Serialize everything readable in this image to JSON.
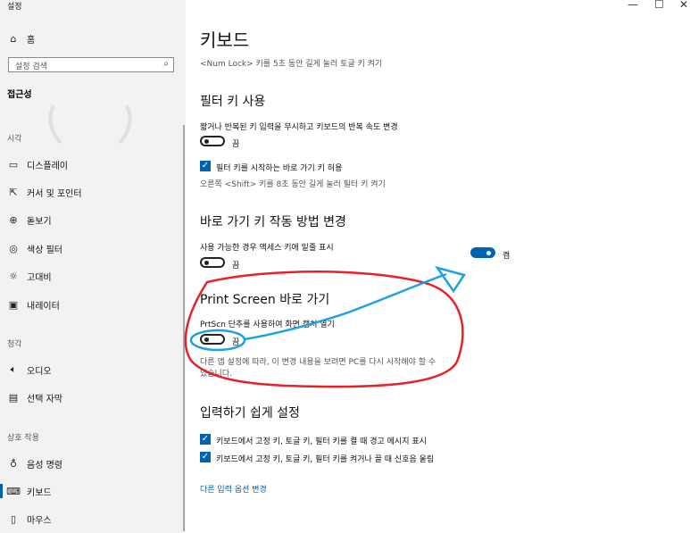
{
  "app": {
    "title": "설정"
  },
  "sidebar": {
    "home": "홈",
    "search_placeholder": "설정 검색",
    "category": "접근성",
    "sections": {
      "vision": "시각",
      "hearing": "청각",
      "interaction": "상호 작용"
    },
    "vision_items": [
      "디스플레이",
      "커서 및 포인터",
      "돋보기",
      "색상 필터",
      "고대비",
      "내레이터"
    ],
    "hearing_items": [
      "오디오",
      "선택 자막"
    ],
    "interaction_items": [
      "음성 명령",
      "키보드",
      "마우스"
    ]
  },
  "main": {
    "title": "키보드",
    "numlock_text": "<Num Lock> 키를 5초 동안 길게 눌러 토글 키 켜기",
    "filter_keys": {
      "heading": "필터 키 사용",
      "description": "짧거나 반복된 키 입력을 무시하고 키보드의 반복 속도 변경",
      "toggle_state": "끔",
      "checkbox_label": "필터 키를 시작하는 바로 가기 키 허용",
      "shift_text": "오른쪽 <Shift> 키를 8초 동안 길게 눌러 필터 키 켜기"
    },
    "shortcut_keys": {
      "heading": "바로 가기 키 작동 방법 변경",
      "description": "사용 가능한 경우 액세스 키에 밑줄 표시",
      "toggle_state": "끔"
    },
    "print_screen": {
      "heading": "Print Screen 바로 가기",
      "description": "PrtScn 단추를 사용하여 화면 캡처 열기",
      "toggle_state": "끔",
      "note_line1": "다른 앱 설정에 따라, 이 변경 내용을 보려면 PC를 다시 시작해야 할 수",
      "note_line2": "있습니다."
    },
    "ease_typing": {
      "heading": "입력하기 쉽게 설정",
      "checkbox1": "키보드에서 고정 키, 토글 키, 필터 키를 켤 때 경고 메시지 표시",
      "checkbox2": "키보드에서 고정 키, 토글 키, 필터 키를 켜거나 끌 때 신호음 울림"
    },
    "other_link": "다른 입력 옵션 변경"
  },
  "annotation": {
    "toggle_state": "켬",
    "toggle_on": true
  },
  "colors": {
    "accent": "#0063b1",
    "annot_red": "#e8202a",
    "annot_blue": "#1ea0e6"
  }
}
